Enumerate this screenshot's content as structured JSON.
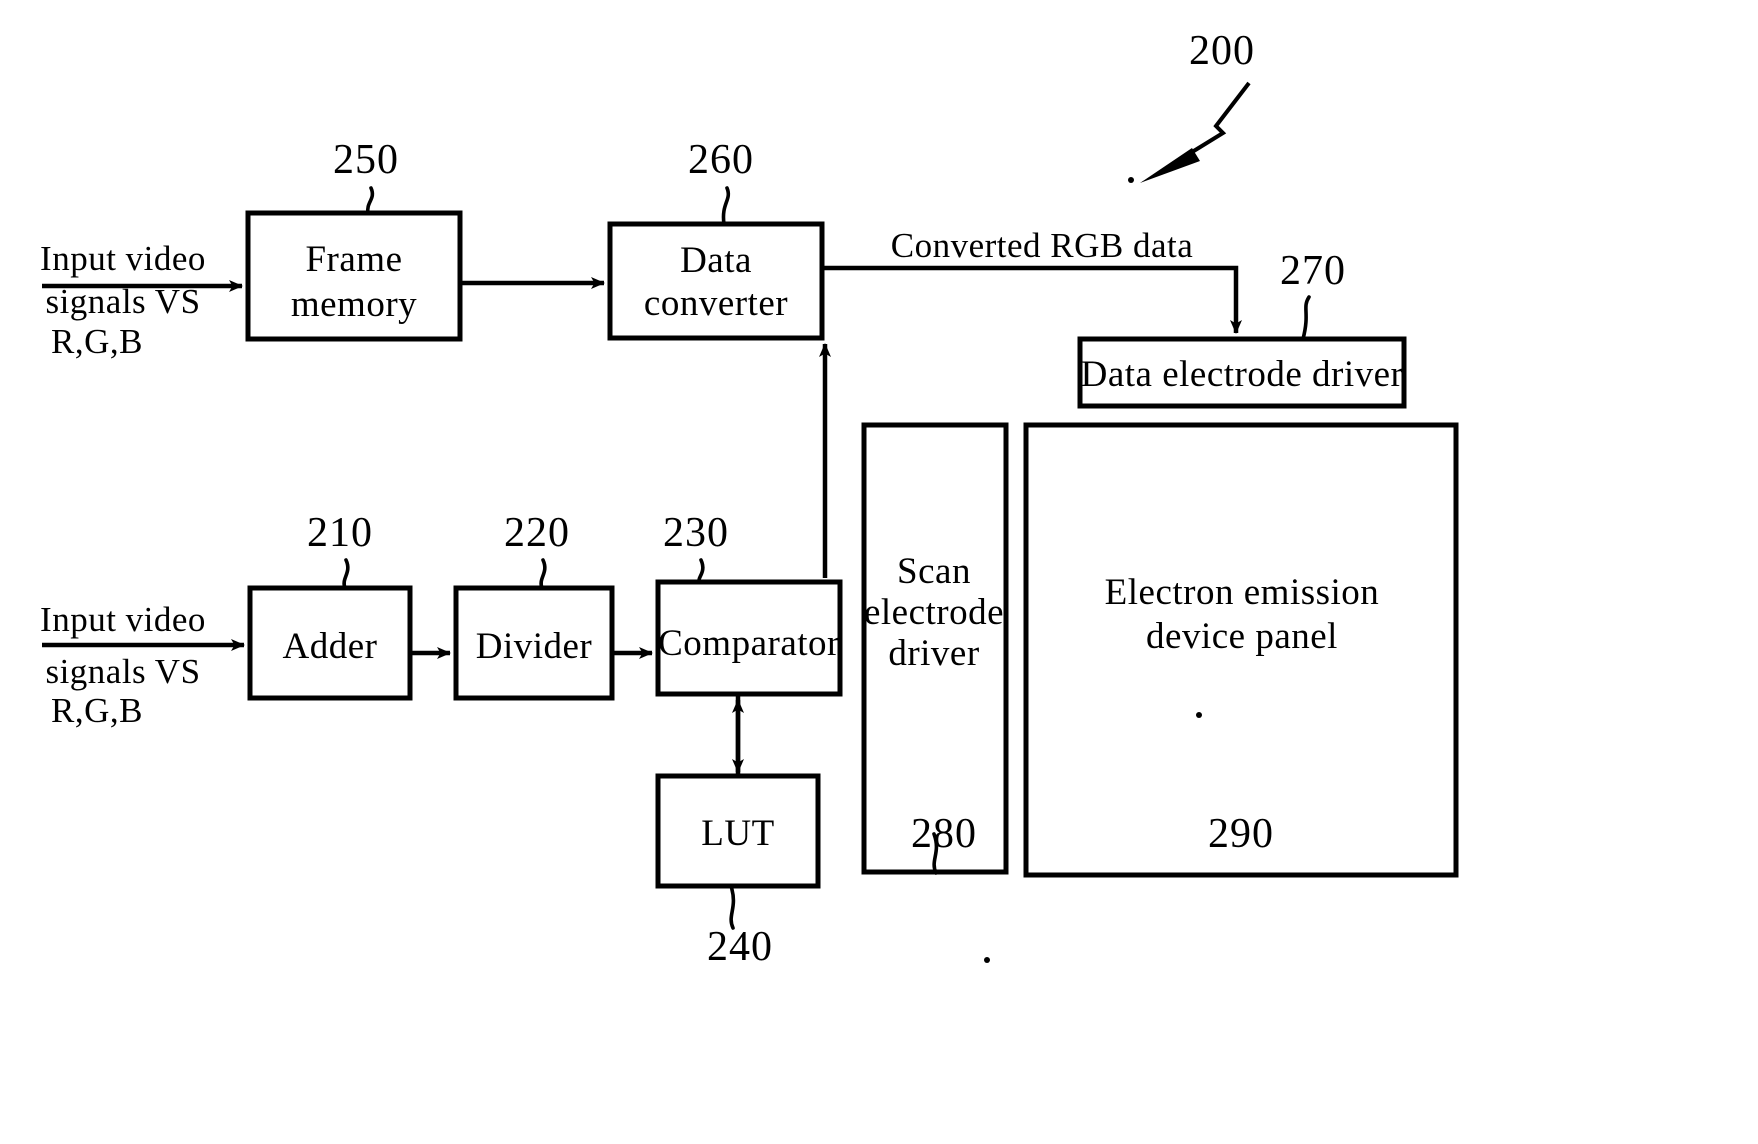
{
  "figure": {
    "type": "patent-block-diagram",
    "overall_ref": "200",
    "background_color": "#ffffff",
    "line_color": "#000000"
  },
  "blocks": [
    {
      "id": "frame_memory",
      "label_line1": "Frame",
      "label_line2": "memory",
      "ref": "250"
    },
    {
      "id": "data_converter",
      "label_line1": "Data",
      "label_line2": "converter",
      "ref": "260"
    },
    {
      "id": "data_electrode_driver",
      "label_line1": "Data electrode driver",
      "label_line2": "",
      "ref": "270"
    },
    {
      "id": "adder",
      "label_line1": "Adder",
      "label_line2": "",
      "ref": "210"
    },
    {
      "id": "divider",
      "label_line1": "Divider",
      "label_line2": "",
      "ref": "220"
    },
    {
      "id": "comparator",
      "label_line1": "Comparator",
      "label_line2": "",
      "ref": "230"
    },
    {
      "id": "lut",
      "label_line1": "LUT",
      "label_line2": "",
      "ref": "240"
    },
    {
      "id": "scan_electrode_driver",
      "label_line1": "Scan",
      "label_line2": "electrode",
      "label_line3": "driver",
      "ref": "280"
    },
    {
      "id": "electron_emission_device_panel",
      "label_line1": "Electron emission",
      "label_line2": "device panel",
      "ref": "290"
    }
  ],
  "signals": {
    "input_top": {
      "line1": "Input  video",
      "line2": "signals VS",
      "line3": "R,G,B"
    },
    "input_bottom": {
      "line1": "Input  video",
      "line2": "signals VS",
      "line3": "R,G,B"
    },
    "converted_rgb": "Converted RGB data"
  },
  "refs": {
    "r200": "200",
    "r210": "210",
    "r220": "220",
    "r230": "230",
    "r240": "240",
    "r250": "250",
    "r260": "260",
    "r270": "270",
    "r280": "280",
    "r290": "290"
  }
}
